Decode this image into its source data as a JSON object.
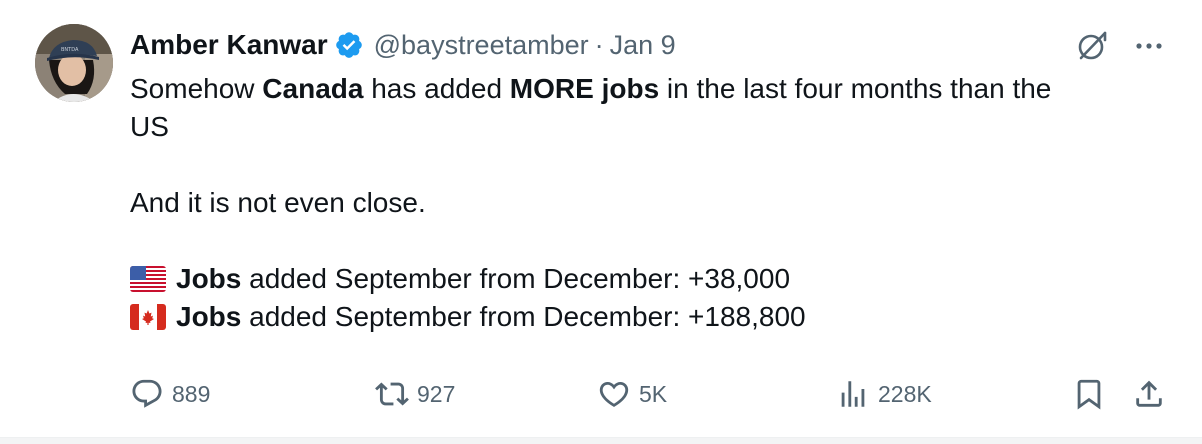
{
  "tweet": {
    "author": {
      "display_name": "Amber Kanwar",
      "handle": "@baystreetamber",
      "separator": "·",
      "date": "Jan 9",
      "verified_color": "#1d9bf0"
    },
    "body": {
      "line1_pre": "Somehow ",
      "line1_bold1": "Canada",
      "line1_mid": " has added ",
      "line1_bold2": "MORE jobs",
      "line1_post": " in the last four months than the",
      "line2": "US",
      "line3": "And it is not even close.",
      "us_line_bold": "Jobs",
      "us_line_rest": " added September from December: +38,000",
      "ca_line_bold": "Jobs",
      "ca_line_rest": " added September from December: +188,800"
    },
    "metrics": {
      "replies": "889",
      "reposts": "927",
      "likes": "5K",
      "views": "228K"
    },
    "icons": [
      "grok-icon",
      "more-icon",
      "verified-badge-icon",
      "us-flag-icon",
      "canada-flag-icon",
      "reply-icon",
      "repost-icon",
      "like-icon",
      "views-icon",
      "bookmark-icon",
      "share-icon"
    ],
    "colors": {
      "text": "#0f1419",
      "muted": "#536471",
      "accent": "#1d9bf0"
    }
  }
}
